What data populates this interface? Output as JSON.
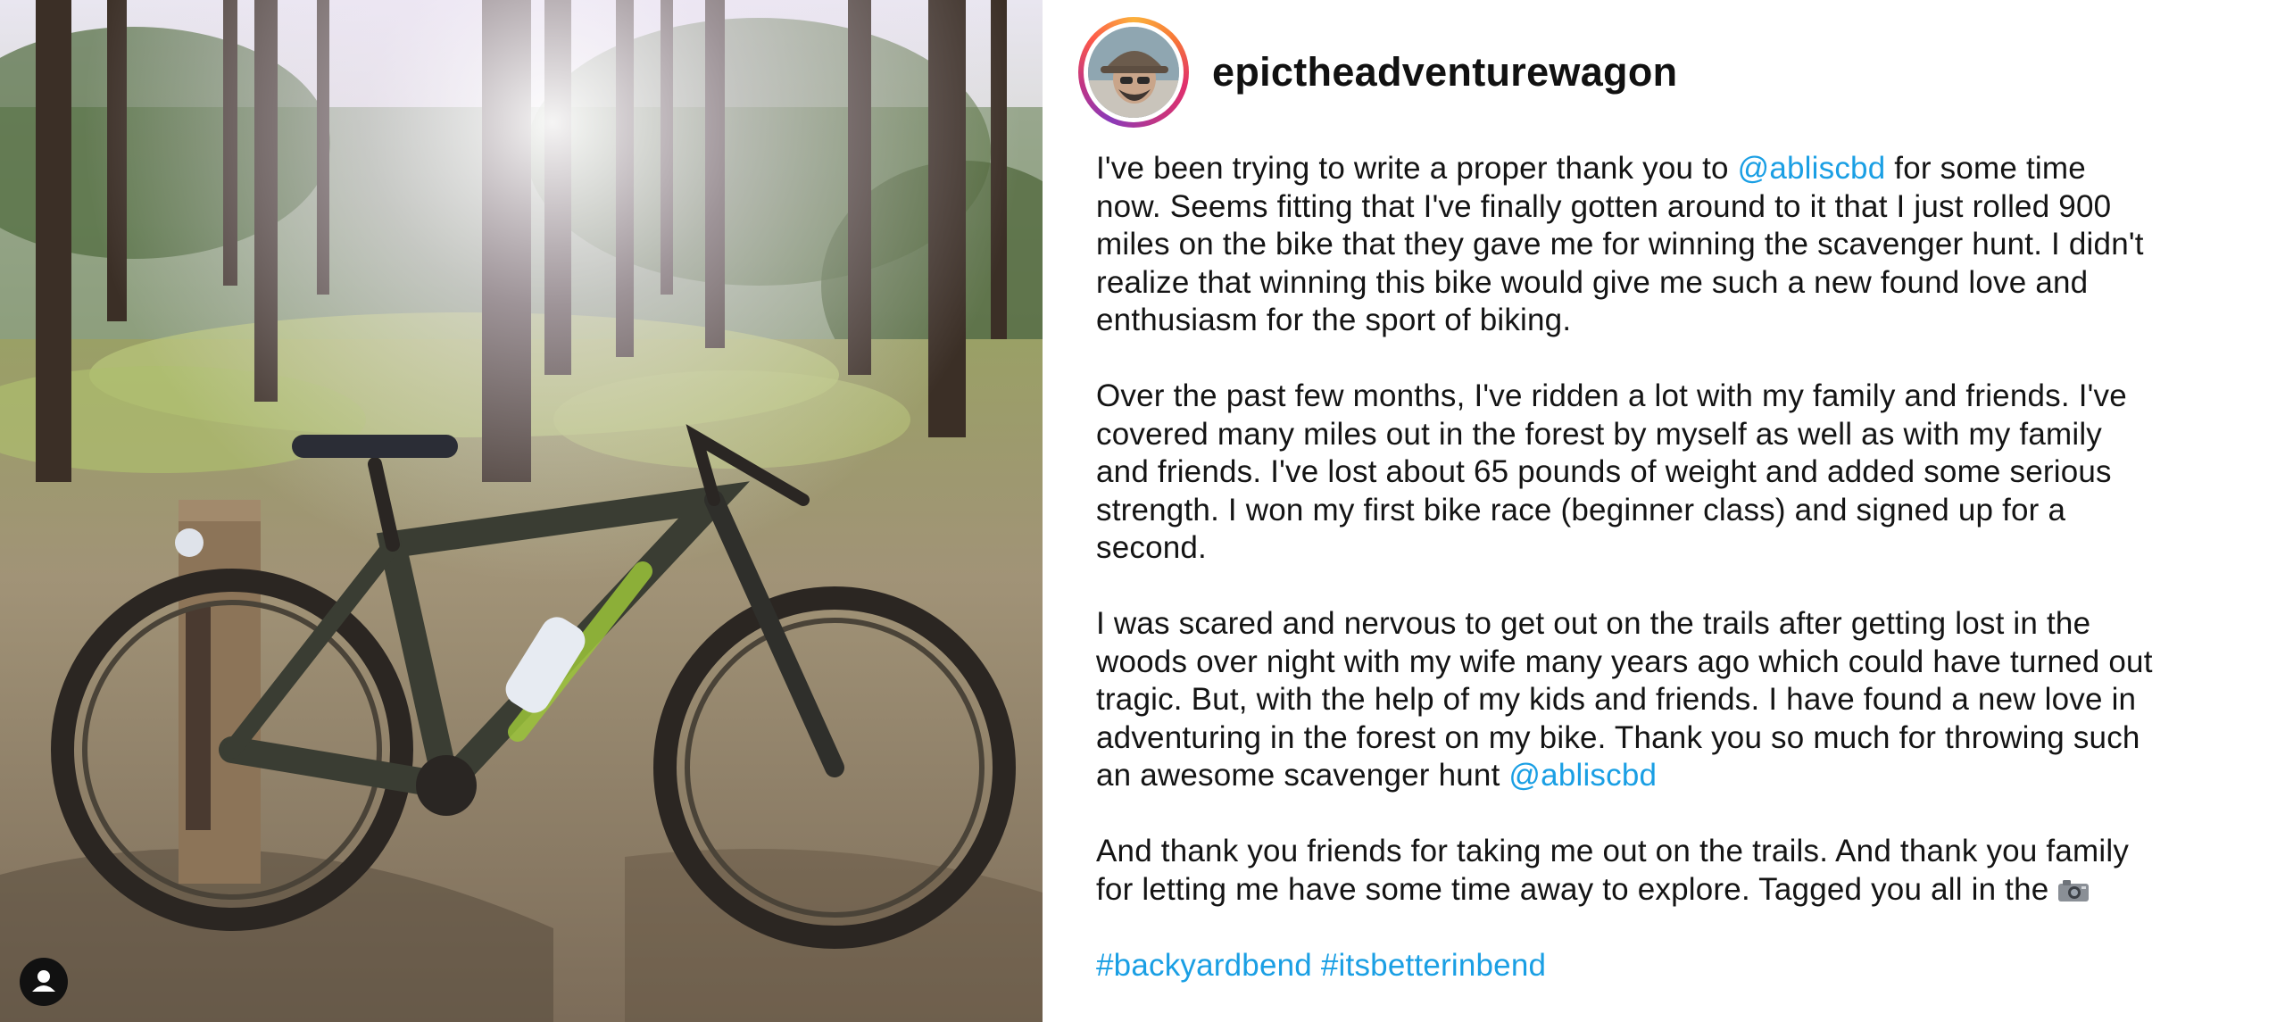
{
  "post": {
    "username": "epictheadventurewagon",
    "photo": {
      "description_icon": "bicycle-photo",
      "tag_icon": "person-tag-icon"
    },
    "caption": {
      "p1": {
        "l1_a": "I've been trying to write a proper thank you to ",
        "l1_mention": "@abliscbd",
        "l1_b": " for some time",
        "l2": "now. Seems fitting that I've finally gotten around to it that I just rolled 900",
        "l3": "miles on the bike that they gave me for winning the scavenger hunt. I didn't",
        "l4": "realize that winning this bike would give me such a new found love and",
        "l5": "enthusiasm for the sport of biking."
      },
      "p2": {
        "l1": "Over the past few months, I've ridden a lot with my family and friends. I've",
        "l2": "covered many miles out in the forest by myself as well as with my family",
        "l3": "and friends. I've lost about 65 pounds of weight and added some serious",
        "l4": "strength. I won my first bike race (beginner class) and signed up for a",
        "l5": "second."
      },
      "p3": {
        "l1": "I was scared and nervous to get out on the trails after getting lost in the",
        "l2": "woods over night with my wife many years ago which could have turned out",
        "l3": "tragic. But, with the help of my kids and friends. I have found a new love in",
        "l4": "adventuring in the forest on my bike. Thank you so much for throwing such",
        "l5_a": "an awesome scavenger hunt ",
        "l5_mention": "@abliscbd"
      },
      "p4": {
        "l1": "And thank you friends for taking me out on the trails. And thank you family",
        "l2_a": "for letting me have some time away to explore. Tagged you all in the ",
        "l2_icon": "camera-icon"
      },
      "hashtags": [
        "#backyardbend",
        "#itsbetterinbend"
      ]
    }
  },
  "colors": {
    "link": "#1a9fe4",
    "text": "#141414",
    "username": "#111111"
  }
}
